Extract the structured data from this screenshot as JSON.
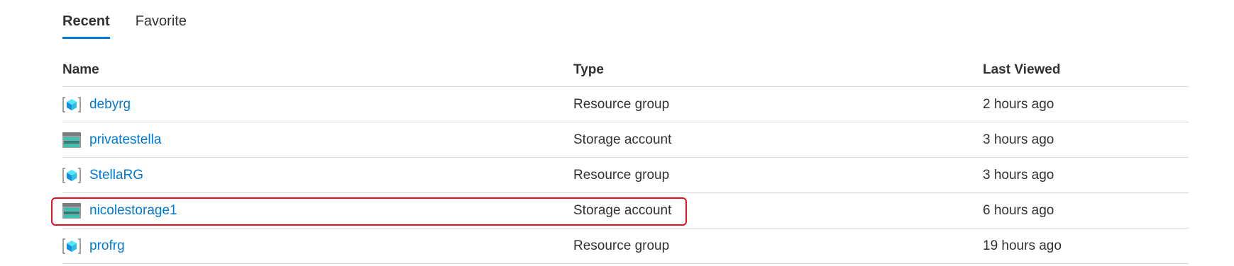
{
  "tabs": [
    {
      "label": "Recent",
      "active": true
    },
    {
      "label": "Favorite",
      "active": false
    }
  ],
  "table": {
    "columns": [
      "Name",
      "Type",
      "Last Viewed"
    ],
    "rows": [
      {
        "name": "debyrg",
        "type": "Resource group",
        "last_viewed": "2 hours ago",
        "icon": "resource-group-icon"
      },
      {
        "name": "privatestella",
        "type": "Storage account",
        "last_viewed": "3 hours ago",
        "icon": "storage-account-icon"
      },
      {
        "name": "StellaRG",
        "type": "Resource group",
        "last_viewed": "3 hours ago",
        "icon": "resource-group-icon"
      },
      {
        "name": "nicolestorage1",
        "type": "Storage account",
        "last_viewed": "6 hours ago",
        "icon": "storage-account-icon",
        "highlighted": true
      },
      {
        "name": "profrg",
        "type": "Resource group",
        "last_viewed": "19 hours ago",
        "icon": "resource-group-icon"
      }
    ]
  },
  "colors": {
    "accent": "#0078d4",
    "highlight": "#e81123",
    "divider": "#d6d6d6"
  }
}
